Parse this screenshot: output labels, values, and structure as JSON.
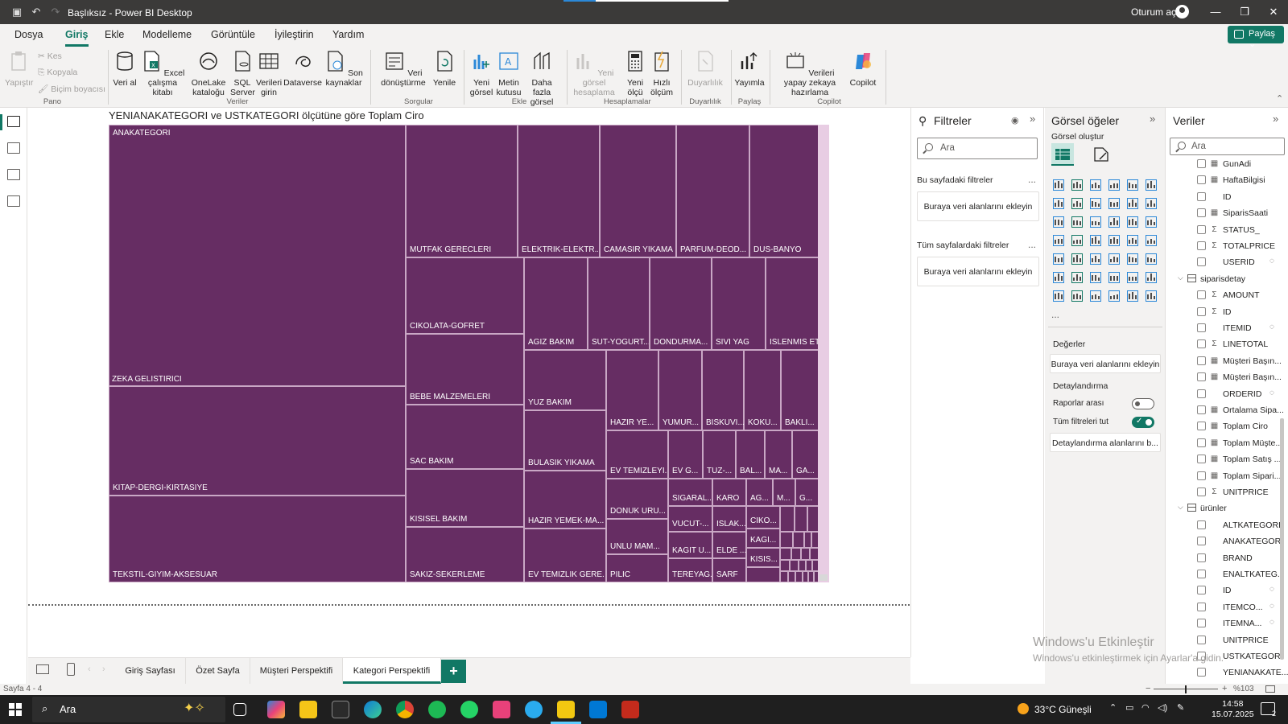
{
  "window": {
    "title": "Başlıksız - Power BI Desktop",
    "signin": "Oturum aç"
  },
  "menu": {
    "tabs": [
      "Dosya",
      "Giriş",
      "Ekle",
      "Modelleme",
      "Görüntüle",
      "İyileştirin",
      "Yardım"
    ],
    "active": "Giriş",
    "share_label": "Paylaş"
  },
  "ribbon": {
    "paste": "Yapıştır",
    "cut": "Kes",
    "copy": "Kopyala",
    "format_painter": "Biçim boyacısı",
    "get_data": "Veri al",
    "excel": "Excel çalışma kitabı",
    "onelake": "OneLake kataloğu",
    "sql": "SQL Server",
    "enter_data": "Verileri girin",
    "dataverse": "Dataverse",
    "recent": "Son kaynaklar",
    "transform": "Veri dönüştürme",
    "refresh": "Yenile",
    "new_visual": "Yeni görsel",
    "textbox": "Metin kutusu",
    "more_visuals": "Daha fazla görsel",
    "new_calc": "Yeni görsel hesaplama",
    "new_measure": "Yeni ölçü",
    "quick_measure": "Hızlı ölçüm",
    "sensitivity": "Duyarlılık",
    "publish": "Yayımla",
    "ai_prep": "Verileri yapay zekaya hazırlama",
    "copilot": "Copilot",
    "groups": [
      "Pano",
      "Veriler",
      "Sorgular",
      "Ekle",
      "Hesaplamalar",
      "Duyarlılık",
      "Paylaş",
      "Copilot"
    ]
  },
  "visual": {
    "title": "YENIANAKATEGORI ve USTKATEGORI ölçütüne göre Toplam Ciro"
  },
  "treemap": {
    "color": "#662d63",
    "tiles": [
      "ANAKATEGORI",
      "ZEKA GELISTIRICI",
      "KITAP-DERGI-KIRTASIYE",
      "TEKSTIL-GIYIM-AKSESUAR",
      "MUTFAK GERECLERI",
      "ELEKTRIK-ELEKTR...",
      "CAMASIR YIKAMA",
      "PARFUM-DEOD...",
      "DUS-BANYO",
      "CIKOLATA-GOFRET",
      "AGIZ BAKIM",
      "SUT-YOGURT...",
      "DONDURMA...",
      "SIVI YAG",
      "ISLENMIS ET",
      "BEBE MALZEMELERI",
      "YUZ BAKIM",
      "HAZIR YE...",
      "YUMUR...",
      "BISKUVI...",
      "KOKU...",
      "BAKLI...",
      "SAC BAKIM",
      "BULASIK YIKAMA",
      "EV TEMIZLEYI...",
      "EV G...",
      "TUZ-...",
      "BAL...",
      "MA...",
      "GA...",
      "KISISEL BAKIM",
      "HAZIR YEMEK-MA...",
      "DONUK URU...",
      "SIGARAL...",
      "KARO",
      "AG...",
      "M...",
      "G...",
      "VUCUT-...",
      "ISLAK...",
      "CIKO...",
      "UNLU MAM...",
      "KAGIT U...",
      "ELDE ...",
      "KAGI...",
      "KISIS...",
      "SAKIZ-SEKERLEME",
      "EV TEMIZLIK GERE...",
      "PILIC",
      "TEREYAG...",
      "SARF"
    ]
  },
  "pagetabs": {
    "pages": [
      "Giriş Sayfası",
      "Özet Sayfa",
      "Müşteri Perspektifi",
      "Kategori Perspektifi"
    ],
    "active": "Kategori Perspektifi",
    "add": "+"
  },
  "status": {
    "page": "Sayfa 4 - 4",
    "zoom": "%103"
  },
  "filters": {
    "title": "Filtreler",
    "search_placeholder": "Ara",
    "this_page": "Bu sayfadaki filtreler",
    "all_pages": "Tüm sayfalardaki filtreler",
    "dropzone": "Buraya veri alanlarını ekleyin",
    "more": "..."
  },
  "viz": {
    "title": "Görsel öğeler",
    "build": "Görsel oluştur",
    "values": "Değerler",
    "values_drop": "Buraya veri alanlarını ekleyin",
    "drillthrough": "Detaylandırma",
    "cross_report": "Raporlar arası",
    "keep_filters": "Tüm filtreleri tut",
    "drill_drop": "Detaylandırma alanlarını b...",
    "more": "..."
  },
  "data": {
    "title": "Veriler",
    "search_placeholder": "Ara",
    "fields_top": [
      {
        "name": "GunAdi",
        "icon": "calc",
        "hidden": false
      },
      {
        "name": "HaftaBilgisi",
        "icon": "calc",
        "hidden": false
      },
      {
        "name": "ID",
        "icon": "",
        "hidden": false
      },
      {
        "name": "SiparisSaati",
        "icon": "calc",
        "hidden": false
      },
      {
        "name": "STATUS_",
        "icon": "sigma",
        "hidden": false
      },
      {
        "name": "TOTALPRICE",
        "icon": "sigma",
        "hidden": false
      },
      {
        "name": "USERID",
        "icon": "",
        "hidden": true
      }
    ],
    "table2": "siparisdetay",
    "fields_mid": [
      {
        "name": "AMOUNT",
        "icon": "sigma",
        "hidden": false
      },
      {
        "name": "ID",
        "icon": "sigma",
        "hidden": false
      },
      {
        "name": "ITEMID",
        "icon": "",
        "hidden": true
      },
      {
        "name": "LINETOTAL",
        "icon": "sigma",
        "hidden": false
      },
      {
        "name": "Müşteri Başın...",
        "icon": "calc",
        "hidden": false
      },
      {
        "name": "Müşteri Başın...",
        "icon": "calc",
        "hidden": false
      },
      {
        "name": "ORDERID",
        "icon": "",
        "hidden": true
      },
      {
        "name": "Ortalama Sipa...",
        "icon": "calc",
        "hidden": false
      },
      {
        "name": "Toplam Ciro",
        "icon": "calc",
        "hidden": false
      },
      {
        "name": "Toplam Müşte...",
        "icon": "calc",
        "hidden": false
      },
      {
        "name": "Toplam Satış ...",
        "icon": "calc",
        "hidden": false
      },
      {
        "name": "Toplam Sipari...",
        "icon": "calc",
        "hidden": false
      },
      {
        "name": "UNITPRICE",
        "icon": "sigma",
        "hidden": false
      }
    ],
    "table3": "ürünler",
    "fields_bot": [
      {
        "name": "ALTKATEGORI",
        "icon": "",
        "hidden": false
      },
      {
        "name": "ANAKATEGORI",
        "icon": "",
        "hidden": false
      },
      {
        "name": "BRAND",
        "icon": "",
        "hidden": false
      },
      {
        "name": "ENALTKATEG...",
        "icon": "",
        "hidden": false
      },
      {
        "name": "ID",
        "icon": "",
        "hidden": true
      },
      {
        "name": "ITEMCO...",
        "icon": "",
        "hidden": true
      },
      {
        "name": "ITEMNA...",
        "icon": "",
        "hidden": true
      },
      {
        "name": "UNITPRICE",
        "icon": "",
        "hidden": false
      },
      {
        "name": "USTKATEGORI",
        "icon": "",
        "hidden": false
      },
      {
        "name": "YENIANAKATE...",
        "icon": "",
        "hidden": false
      }
    ]
  },
  "watermark": {
    "line1": "Windows'u Etkinleştir",
    "line2": "Windows'u etkinleştirmek için Ayarlar'a gidin."
  },
  "taskbar": {
    "search": "Ara",
    "weather": "33°C Güneşli",
    "time": "14:58",
    "date": "15.07.2025",
    "notif": "2"
  }
}
